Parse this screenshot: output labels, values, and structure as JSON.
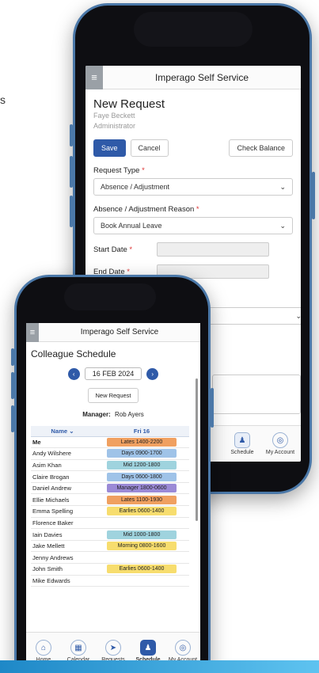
{
  "stray_text": "s",
  "back_phone": {
    "app_title": "Imperago Self Service",
    "page_title": "New Request",
    "user_name": "Faye Beckett",
    "user_role": "Administrator",
    "buttons": {
      "save": "Save",
      "cancel": "Cancel",
      "check_balance": "Check Balance"
    },
    "request_type": {
      "label": "Request Type",
      "value": "Absence / Adjustment"
    },
    "reason": {
      "label": "Absence / Adjustment Reason",
      "value": "Book Annual Leave"
    },
    "start_date_label": "Start Date",
    "end_date_label": "End Date",
    "required_marker": "*",
    "nav": {
      "schedule": "Schedule",
      "my_account": "My Account"
    }
  },
  "front_phone": {
    "app_title": "Imperago Self Service",
    "page_title": "Colleague Schedule",
    "date": "16 FEB 2024",
    "new_request": "New Request",
    "manager_label": "Manager:",
    "manager_name": "Rob Ayers",
    "table": {
      "col_name": "Name",
      "col_day": "Fri 16",
      "rows": [
        {
          "name": "Me",
          "shift": "Lates 1400-2200",
          "color": "#f0a060"
        },
        {
          "name": "Andy Wilshere",
          "shift": "Days 0900-1700",
          "color": "#9fc3e8"
        },
        {
          "name": "Asim Khan",
          "shift": "Mid 1200-1800",
          "color": "#9fd3de"
        },
        {
          "name": "Claire Brogan",
          "shift": "Days 0600-1800",
          "color": "#9fc3e8"
        },
        {
          "name": "Daniel Andrew",
          "shift": "Manager 1800-0600",
          "color": "#9b8ad6"
        },
        {
          "name": "Ellie Michaels",
          "shift": "Lates 1100-1930",
          "color": "#f0a060"
        },
        {
          "name": "Emma Spelling",
          "shift": "Earlies 0600-1400",
          "color": "#f7dd6e"
        },
        {
          "name": "Florence Baker",
          "shift": "",
          "color": ""
        },
        {
          "name": "Iain Davies",
          "shift": "Mid 1000-1800",
          "color": "#9fd3de"
        },
        {
          "name": "Jake Mellett",
          "shift": "Morning 0800-1600",
          "color": "#f7dd6e"
        },
        {
          "name": "Jenny Andrews",
          "shift": "",
          "color": ""
        },
        {
          "name": "John Smith",
          "shift": "Earlies 0600-1400",
          "color": "#f7dd6e"
        },
        {
          "name": "Mike Edwards",
          "shift": "",
          "color": ""
        }
      ]
    },
    "nav": {
      "home": "Home",
      "calendar": "Calendar",
      "requests": "Requests",
      "schedule": "Schedule",
      "my_account": "My Account"
    }
  },
  "colors": {
    "primary": "#2f5aa8",
    "frame_accent": "#4b78a8"
  }
}
